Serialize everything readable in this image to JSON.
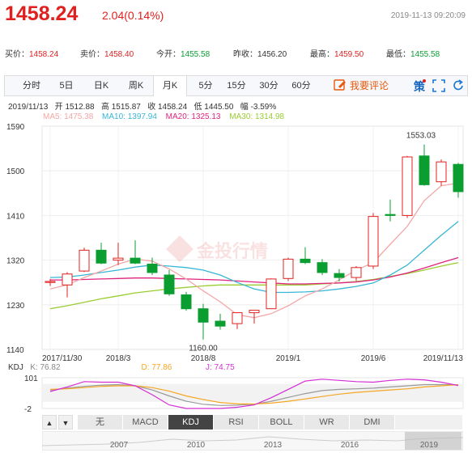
{
  "header": {
    "price": "1458.24",
    "change": "2.04(0.14%)",
    "datetime": "2019-11-13 09:20:09"
  },
  "quote": {
    "buy_label": "买价：",
    "buy": "1458.24",
    "sell_label": "卖价：",
    "sell": "1458.40",
    "open_label": "今开：",
    "open": "1455.58",
    "prev_close_label": "昨收：",
    "prev_close": "1456.20",
    "high_label": "最高：",
    "high": "1459.50",
    "low_label": "最低：",
    "low": "1455.58"
  },
  "tabs": [
    "分时",
    "5日",
    "日K",
    "周K",
    "月K",
    "5分",
    "15分",
    "30分",
    "60分"
  ],
  "active_tab": "月K",
  "comment_label": "我要评论",
  "info": {
    "date": "2019/11/13",
    "open_label": "开",
    "open": "1512.88",
    "high_label": "高",
    "high": "1515.87",
    "close_label": "收",
    "close": "1458.24",
    "low_label": "低",
    "low": "1445.50",
    "amp_label": "幅",
    "amp": "-3.59%"
  },
  "ma": {
    "ma5": "MA5: 1475.38",
    "ma10": "MA10: 1397.94",
    "ma20": "MA20: 1325.13",
    "ma30": "MA30: 1314.98"
  },
  "colors": {
    "up": "#e0201f",
    "down": "#0a9e30",
    "ma5": "#f4a6a6",
    "ma10": "#37b6d6",
    "ma20": "#e0237f",
    "ma30": "#9acd32"
  },
  "chart_data": {
    "type": "candlestick",
    "yticks": [
      "1590",
      "1500",
      "1410",
      "1320",
      "1230",
      "1140"
    ],
    "ylim": [
      1140,
      1590
    ],
    "xticks": [
      "2017/11/30",
      "2018/3",
      "2018/8",
      "2019/1",
      "2019/6",
      "2019/11/13"
    ],
    "annotations": {
      "max": "1553.03",
      "min": "1160.00"
    },
    "candles": [
      {
        "o": 1275,
        "h": 1282,
        "l": 1268,
        "c": 1277
      },
      {
        "o": 1270,
        "h": 1296,
        "l": 1245,
        "c": 1292
      },
      {
        "o": 1298,
        "h": 1345,
        "l": 1296,
        "c": 1340
      },
      {
        "o": 1340,
        "h": 1355,
        "l": 1312,
        "c": 1314
      },
      {
        "o": 1320,
        "h": 1355,
        "l": 1310,
        "c": 1324
      },
      {
        "o": 1324,
        "h": 1360,
        "l": 1312,
        "c": 1314
      },
      {
        "o": 1312,
        "h": 1325,
        "l": 1290,
        "c": 1295
      },
      {
        "o": 1290,
        "h": 1300,
        "l": 1248,
        "c": 1252
      },
      {
        "o": 1250,
        "h": 1256,
        "l": 1218,
        "c": 1222
      },
      {
        "o": 1222,
        "h": 1232,
        "l": 1160,
        "c": 1195
      },
      {
        "o": 1197,
        "h": 1212,
        "l": 1180,
        "c": 1187
      },
      {
        "o": 1192,
        "h": 1215,
        "l": 1181,
        "c": 1214
      },
      {
        "o": 1214,
        "h": 1218,
        "l": 1192,
        "c": 1219
      },
      {
        "o": 1222,
        "h": 1283,
        "l": 1222,
        "c": 1282
      },
      {
        "o": 1283,
        "h": 1325,
        "l": 1278,
        "c": 1322
      },
      {
        "o": 1322,
        "h": 1346,
        "l": 1312,
        "c": 1315
      },
      {
        "o": 1315,
        "h": 1322,
        "l": 1290,
        "c": 1295
      },
      {
        "o": 1293,
        "h": 1302,
        "l": 1277,
        "c": 1285
      },
      {
        "o": 1285,
        "h": 1308,
        "l": 1278,
        "c": 1305
      },
      {
        "o": 1308,
        "h": 1415,
        "l": 1302,
        "c": 1408
      },
      {
        "o": 1412,
        "h": 1442,
        "l": 1398,
        "c": 1410
      },
      {
        "o": 1410,
        "h": 1530,
        "l": 1405,
        "c": 1528
      },
      {
        "o": 1530,
        "h": 1553,
        "l": 1470,
        "c": 1472
      },
      {
        "o": 1478,
        "h": 1523,
        "l": 1470,
        "c": 1518
      },
      {
        "o": 1513,
        "h": 1516,
        "l": 1446,
        "c": 1458
      }
    ],
    "ma5": [
      1262,
      1270,
      1285,
      1298,
      1312,
      1322,
      1318,
      1302,
      1282,
      1258,
      1236,
      1210,
      1204,
      1212,
      1228,
      1248,
      1262,
      1280,
      1300,
      1315,
      1352,
      1388,
      1440,
      1470,
      1475
    ],
    "ma10": [
      1285,
      1286,
      1290,
      1295,
      1300,
      1306,
      1310,
      1308,
      1305,
      1300,
      1290,
      1275,
      1262,
      1255,
      1255,
      1256,
      1258,
      1262,
      1267,
      1274,
      1290,
      1310,
      1340,
      1370,
      1398
    ],
    "ma20": [
      1280,
      1280,
      1281,
      1282,
      1283,
      1284,
      1284,
      1283,
      1282,
      1281,
      1280,
      1278,
      1276,
      1274,
      1272,
      1272,
      1273,
      1274,
      1276,
      1280,
      1286,
      1294,
      1304,
      1315,
      1325
    ],
    "ma30": [
      1222,
      1228,
      1235,
      1242,
      1248,
      1254,
      1258,
      1262,
      1265,
      1268,
      1270,
      1270,
      1270,
      1270,
      1270,
      1270,
      1272,
      1274,
      1277,
      1281,
      1287,
      1293,
      1300,
      1308,
      1315
    ]
  },
  "kdj": {
    "label": "KDJ",
    "k": "K: 76.82",
    "d": "D: 77.86",
    "j": "J: 74.75",
    "yticks": [
      "101",
      "-2"
    ],
    "k_values": [
      60,
      66,
      72,
      76,
      78,
      74,
      60,
      40,
      22,
      12,
      8,
      9,
      12,
      22,
      35,
      48,
      58,
      62,
      64,
      66,
      70,
      74,
      78,
      78,
      77
    ],
    "d_values": [
      62,
      64,
      68,
      72,
      74,
      74,
      68,
      56,
      40,
      28,
      18,
      14,
      13,
      16,
      22,
      30,
      38,
      46,
      52,
      56,
      60,
      64,
      70,
      74,
      78
    ],
    "j_values": [
      55,
      70,
      88,
      86,
      86,
      74,
      44,
      10,
      -2,
      -2,
      -2,
      2,
      10,
      34,
      62,
      90,
      96,
      92,
      88,
      86,
      92,
      96,
      94,
      86,
      75
    ]
  },
  "bottom_tabs": [
    "无",
    "MACD",
    "KDJ",
    "RSI",
    "BOLL",
    "WR",
    "DMI"
  ],
  "active_bottom_tab": "KDJ",
  "nav_buttons": [
    "▲",
    "▼"
  ],
  "navigator_years": [
    "2007",
    "2010",
    "2013",
    "2016",
    "2019"
  ]
}
